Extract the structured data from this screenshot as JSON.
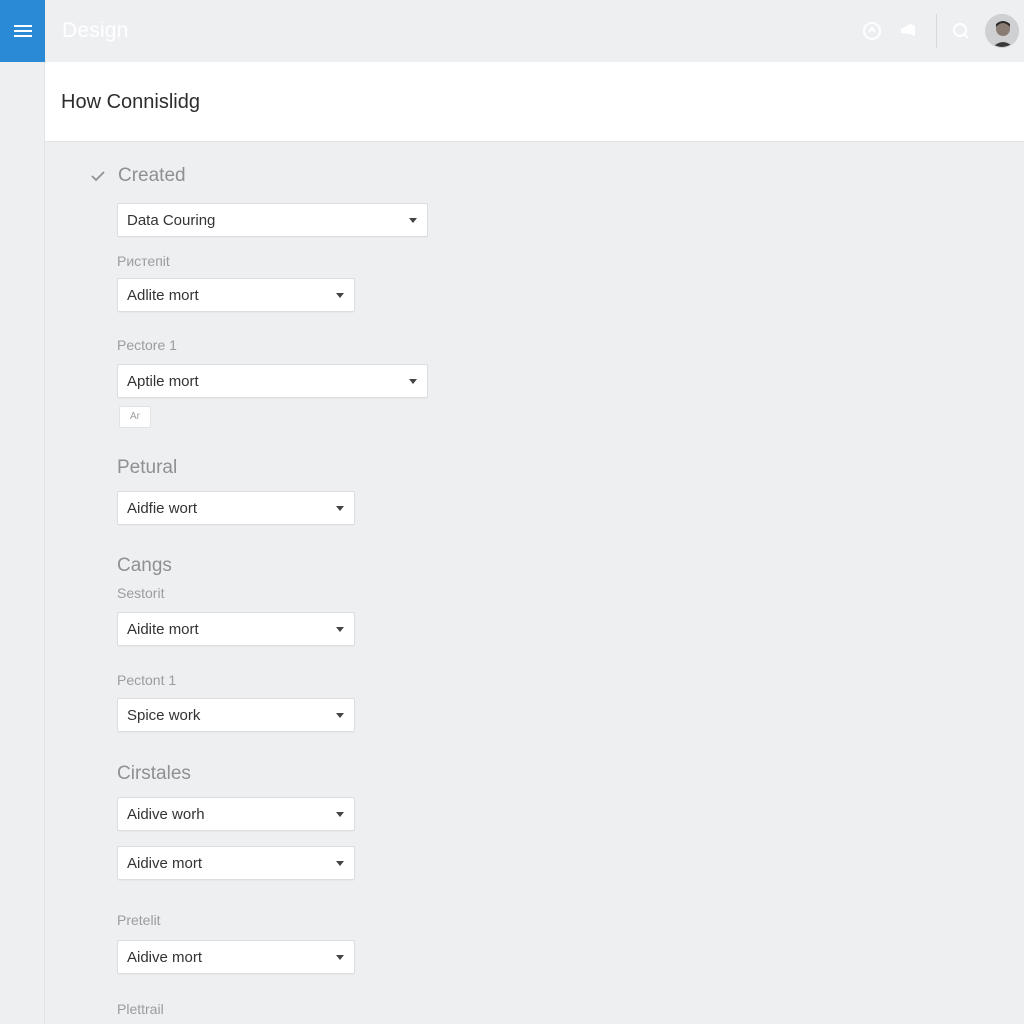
{
  "app": {
    "title": "Design"
  },
  "topbar": {
    "icons": [
      "help-icon",
      "megaphone-icon",
      "search-icon",
      "avatar"
    ],
    "accent_color": "#2a8ad6"
  },
  "header": {
    "title": "How Connislidg"
  },
  "sections": {
    "created": {
      "title": "Created",
      "select1": "Data Couring",
      "label1": "Pистепіt",
      "select2": "Adlite mort",
      "label2": "Pectore 1",
      "select3": "Aptile mort",
      "chip": "Ar"
    },
    "petural": {
      "title": "Petural",
      "select1": "Aidfie wort"
    },
    "cangs": {
      "title": "Cangs",
      "label1": "Sestorit",
      "select1": "Aidite mort",
      "label2": "Pectont 1",
      "select2": "Spice work"
    },
    "cirstales": {
      "title": "Cirstales",
      "select1": "Aidive worh",
      "select2": "Aidive mort",
      "label1": "Pretelit",
      "select3": "Aidive mort",
      "label2": "Plettrail"
    }
  }
}
